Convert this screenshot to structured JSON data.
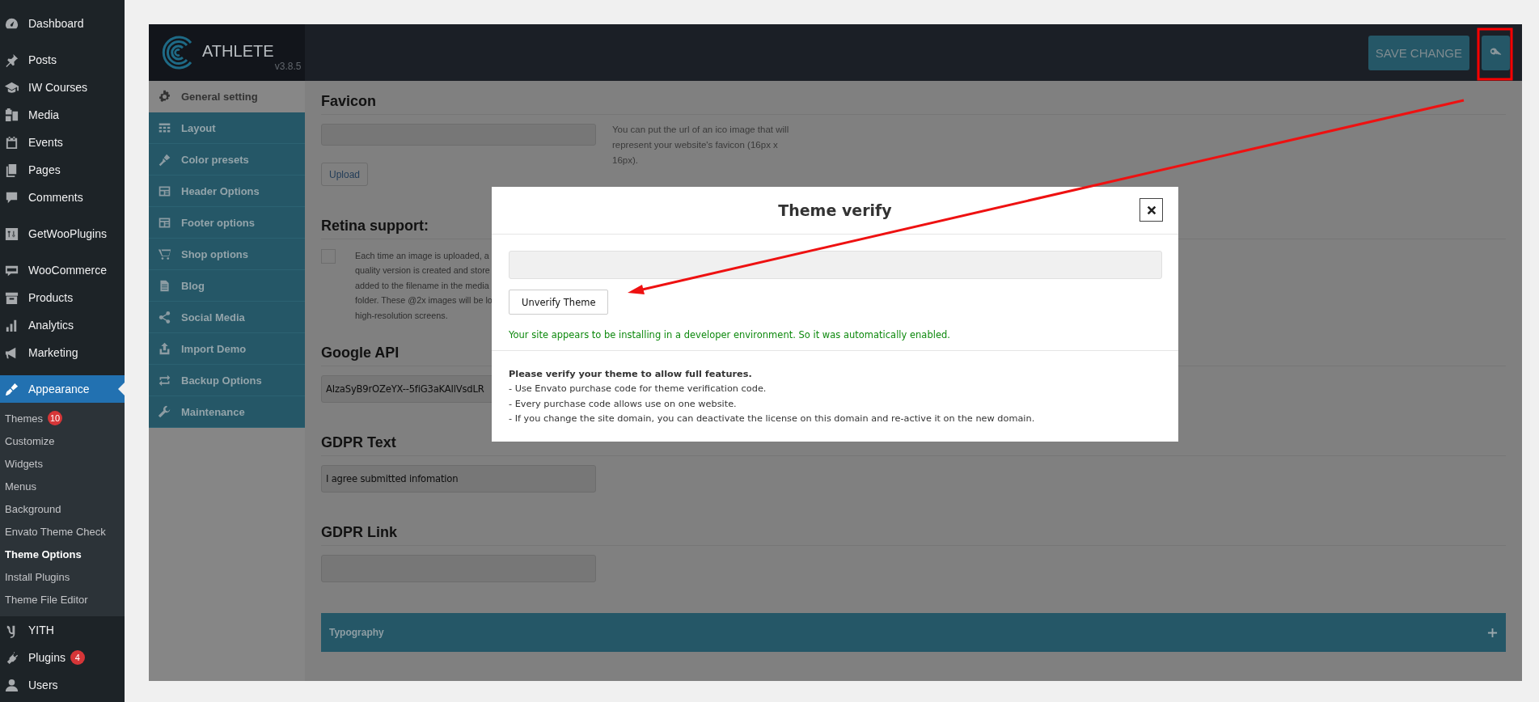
{
  "admin_menu": [
    {
      "items": [
        {
          "label": "Dashboard",
          "selected": false
        }
      ]
    },
    {
      "items": [
        {
          "label": "Posts",
          "selected": false
        },
        {
          "label": "IW Courses",
          "selected": false
        },
        {
          "label": "Media",
          "selected": false
        },
        {
          "label": "Events",
          "selected": false
        },
        {
          "label": "Pages",
          "selected": false
        },
        {
          "label": "Comments",
          "selected": false
        }
      ]
    },
    {
      "items": [
        {
          "label": "GetWooPlugins",
          "selected": false
        }
      ]
    },
    {
      "items": [
        {
          "label": "WooCommerce",
          "selected": false
        },
        {
          "label": "Products",
          "selected": false
        },
        {
          "label": "Analytics",
          "selected": false
        },
        {
          "label": "Marketing",
          "selected": false
        }
      ]
    },
    {
      "items": [
        {
          "label": "Appearance",
          "selected": true,
          "children": [
            {
              "label": "Themes",
              "selected": false,
              "badge": "10"
            },
            {
              "label": "Customize",
              "selected": false
            },
            {
              "label": "Widgets",
              "selected": false
            },
            {
              "label": "Menus",
              "selected": false
            },
            {
              "label": "Background",
              "selected": false
            },
            {
              "label": "Envato Theme Check",
              "selected": false
            },
            {
              "label": "Theme Options",
              "selected": true
            },
            {
              "label": "Install Plugins",
              "selected": false
            },
            {
              "label": "Theme File Editor",
              "selected": false
            }
          ]
        },
        {
          "label": "YITH",
          "selected": false
        },
        {
          "label": "Plugins",
          "selected": false,
          "badge": "4"
        },
        {
          "label": "Users",
          "selected": false
        }
      ]
    }
  ],
  "theme_panel": {
    "logo": {
      "name": "ATHLETE",
      "version": "v3.8.5"
    },
    "save_button": "SAVE CHANGE",
    "nav": [
      {
        "label": "General setting",
        "selected": true
      },
      {
        "label": "Layout",
        "selected": false
      },
      {
        "label": "Color presets",
        "selected": false
      },
      {
        "label": "Header Options",
        "selected": false
      },
      {
        "label": "Footer options",
        "selected": false
      },
      {
        "label": "Shop options",
        "selected": false
      },
      {
        "label": "Blog",
        "selected": false
      },
      {
        "label": "Social Media",
        "selected": false
      },
      {
        "label": "Import Demo",
        "selected": false
      },
      {
        "label": "Backup Options",
        "selected": false
      },
      {
        "label": "Maintenance",
        "selected": false
      }
    ],
    "sections": [
      {
        "kind": "upload",
        "heading": "Favicon",
        "button": "Upload",
        "help": "You can put the url of an ico image that will represent your website's favicon (16px x 16px)."
      },
      {
        "kind": "checkbox",
        "heading": "Retina support:",
        "checked": false,
        "lines": [
          "Each time an image is uploaded, a",
          "quality version is created and store",
          "added to the filename in the media",
          "folder. These @2x images will be lo",
          "high-resolution screens."
        ]
      },
      {
        "kind": "text",
        "heading": "Google API",
        "value": "AIzaSyB9rOZeYX--5fiG3aKAIlVsdLR"
      },
      {
        "kind": "text",
        "heading": "GDPR Text",
        "value": "I agree submitted infomation"
      },
      {
        "kind": "text",
        "heading": "GDPR Link"
      }
    ],
    "group": {
      "label": "Typography",
      "expanded": false
    }
  },
  "modal": {
    "title": "Theme verify",
    "button": "Unverify Theme",
    "notice": "Your site appears to be installing in a developer environment. So it was automatically enabled.",
    "notes": [
      {
        "kind": "heading",
        "text": "Please verify your theme to allow full features."
      },
      {
        "kind": "bullet",
        "text": "- Use Envato purchase code for theme verification code."
      },
      {
        "kind": "bullet",
        "text": "- Every purchase code allows use on one website."
      },
      {
        "kind": "bullet",
        "text": "- If you change the site domain, you can deactivate the license on this domain and re-active it on the new domain."
      }
    ]
  }
}
